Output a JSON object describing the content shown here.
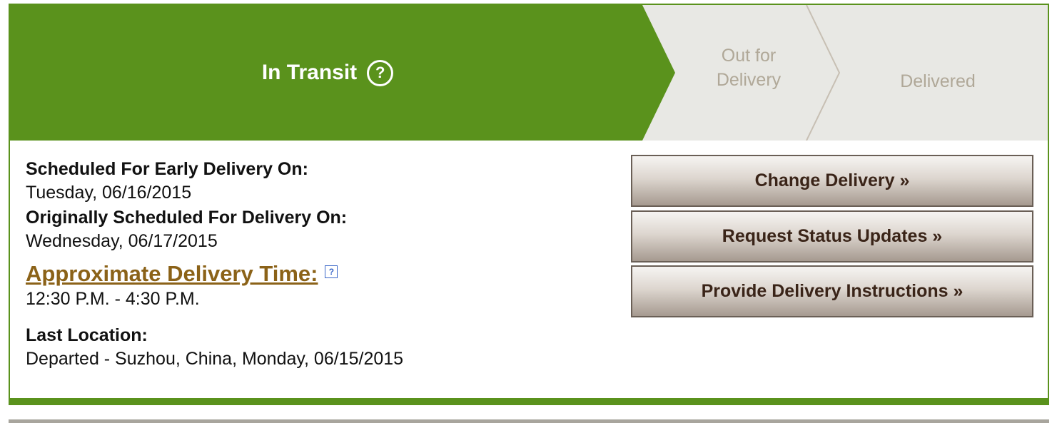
{
  "progress": {
    "active_step": "In Transit",
    "help_symbol": "?",
    "steps": [
      {
        "label_line1": "Out for",
        "label_line2": "Delivery"
      },
      {
        "label": "Delivered"
      }
    ],
    "colors": {
      "active": "#5a921c",
      "inactive": "#e8e8e4",
      "inactive_text": "#b0a898"
    }
  },
  "details": {
    "scheduled_label": "Scheduled For Early Delivery On:",
    "scheduled_value": "Tuesday, 06/16/2015",
    "original_label": "Originally Scheduled For Delivery On:",
    "original_value": "Wednesday, 06/17/2015",
    "approx_label": "Approximate Delivery Time:",
    "approx_help_symbol": "?",
    "approx_value": "12:30 P.M. - 4:30 P.M.",
    "location_label": "Last Location:",
    "location_value": "Departed - Suzhou, China, Monday, 06/15/2015"
  },
  "actions": {
    "change_delivery": "Change Delivery »",
    "status_updates": "Request Status Updates »",
    "delivery_instructions": "Provide Delivery Instructions »"
  }
}
